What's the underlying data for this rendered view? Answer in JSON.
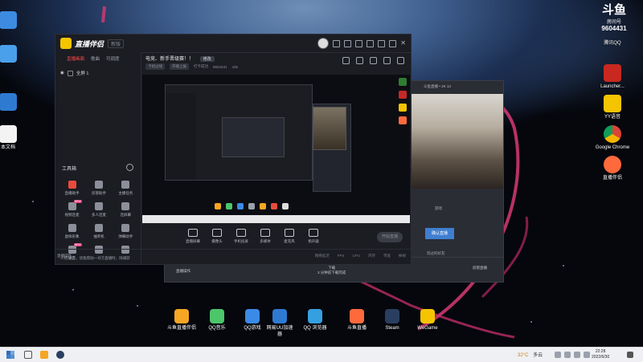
{
  "desktop": {
    "left_icons": [
      {
        "label": "",
        "icon": "blue-window-icon"
      },
      {
        "label": "",
        "icon": "blue-file-icon"
      },
      {
        "label": "",
        "icon": "blue-app-icon"
      },
      {
        "label": "本文档",
        "icon": "document-icon"
      }
    ],
    "right_icons": [
      {
        "label": "腾讯QQ",
        "icon": "qq-icon"
      },
      {
        "label": "Launcher...",
        "icon": "launcher-icon"
      },
      {
        "label": "YY语音",
        "icon": "yy-icon"
      },
      {
        "label": "Google Chrome",
        "icon": "chrome-icon"
      },
      {
        "label": "直播伴侣",
        "icon": "douyu-icon"
      }
    ],
    "dock_icons": [
      {
        "label": "斗鱼直播伴侣",
        "icon": "douyu-icon"
      },
      {
        "label": "QQ音乐",
        "icon": "qq-music-icon"
      },
      {
        "label": "QQ游戏",
        "icon": "qq-game-icon"
      },
      {
        "label": "网易UU加速器",
        "icon": "uu-icon"
      },
      {
        "label": "QQ 浏览器",
        "icon": "qq-browser-icon"
      },
      {
        "label": "斗鱼直播",
        "icon": "douyu-live-icon"
      },
      {
        "label": "Steam",
        "icon": "steam-icon"
      },
      {
        "label": "WeGame",
        "icon": "wegame-icon"
      }
    ],
    "room_badge": {
      "logo": "斗鱼",
      "sub": "房间号",
      "number": "9604431"
    }
  },
  "main_window": {
    "brand": "直播伴侣",
    "version": "新版",
    "tabs": [
      "直播画面",
      "歌曲",
      "可调度"
    ],
    "active_tab": 0,
    "scene_label": "全屏 1",
    "tools_title": "工具箱",
    "tools": [
      {
        "label": "直播助手",
        "badge": "",
        "color": "#e84b3c"
      },
      {
        "label": "房管助手",
        "badge": "",
        "color": "#8c8f99"
      },
      {
        "label": "主播任务",
        "badge": "",
        "color": "#8c8f99"
      },
      {
        "label": "视频连麦",
        "badge": "NEW",
        "color": "#8c8f99"
      },
      {
        "label": "多人连麦",
        "badge": "",
        "color": "#8c8f99"
      },
      {
        "label": "连屏幕",
        "badge": "",
        "color": "#8c8f99"
      },
      {
        "label": "虚拟形象",
        "badge": "",
        "color": "#8c8f99"
      },
      {
        "label": "抽奖机",
        "badge": "",
        "color": "#8c8f99"
      },
      {
        "label": "弹幕助手",
        "badge": "",
        "color": "#8c8f99"
      },
      {
        "label": "语音",
        "badge": "NEW",
        "color": "#8c8f99"
      },
      {
        "label": "",
        "badge": "",
        "color": "#8c8f99"
      },
      {
        "label": "",
        "badge": "",
        "color": "#8c8f99"
      }
    ],
    "left_footer": "人物对话  ，优能帮助一对方直播时，除捕获",
    "room_title": "电竞、新手晋级赛！！",
    "room_title_button": "修改",
    "room_meta": [
      "卡组过线",
      "开播上报",
      "打卡成功",
      "9604431",
      "435"
    ],
    "controls": [
      {
        "label": "直播屏幕",
        "icon": "screen-icon"
      },
      {
        "label": "摄像头",
        "icon": "camera-icon"
      },
      {
        "label": "手机投屏",
        "icon": "phone-cast-icon"
      },
      {
        "label": "多媒体",
        "icon": "media-icon"
      },
      {
        "label": "麦克风",
        "icon": "mic-icon"
      },
      {
        "label": "扬声器",
        "icon": "speaker-icon"
      }
    ],
    "start_button": "开始直播",
    "footer_text": "直播操作",
    "footer_right": [
      "网络延迟",
      "FPS",
      "CPU",
      "内存",
      "带宽",
      "掉帧"
    ]
  },
  "second_window": {
    "left_text": "直播操作",
    "center_text": "下载",
    "center_sub": "3 分钟前下载完成",
    "right_text": "房管直播",
    "side_header": "斗鱼直播 • 2K 13",
    "side_button": "确认直播",
    "side_caption": "玩过的好友",
    "side_tab": "游戏"
  },
  "taskbar": {
    "weather_temp": "32°C",
    "weather_text": "多云",
    "time": "22:28",
    "date": "2022/6/30"
  },
  "colors": {
    "accent": "#f5c400",
    "brand_red": "#e84b3c",
    "highlight_blue": "#3f7fd0"
  }
}
